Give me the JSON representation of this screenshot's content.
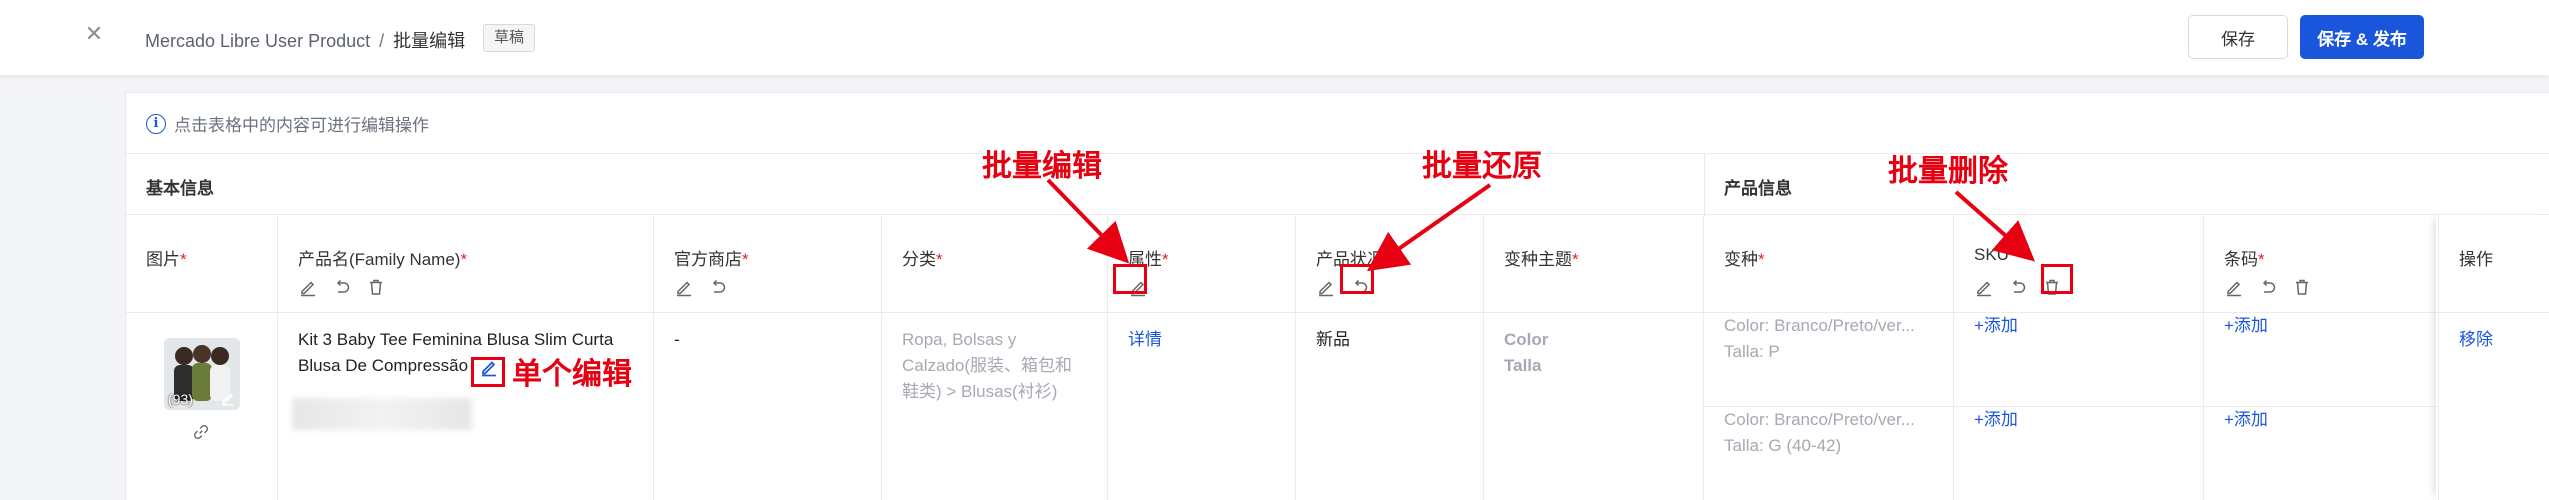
{
  "header": {
    "breadcrumb_root": "Mercado Libre User Product",
    "breadcrumb_sep": "/",
    "breadcrumb_current": "批量编辑",
    "status_tag": "草稿",
    "save_label": "保存",
    "publish_label": "保存 & 发布"
  },
  "info": {
    "hint": "点击表格中的内容可进行编辑操作",
    "icon": "info-icon"
  },
  "groups": {
    "basic": "基本信息",
    "product": "产品信息"
  },
  "columns": {
    "image": "图片",
    "name": "产品名(Family Name)",
    "store": "官方商店",
    "category": "分类",
    "attributes": "属性",
    "condition": "产品状况",
    "variant_theme": "变种主题",
    "variant": "变种",
    "sku": "SKU",
    "barcode": "条码",
    "action": "操作"
  },
  "row": {
    "image_count": "(93)",
    "name_line1": "Kit 3 Baby Tee Feminina Blusa Slim Curta",
    "name_line2": "Blusa De Compressão",
    "store": "-",
    "category_line1": "Ropa, Bolsas y",
    "category_line2": "Calzado(服装、箱包和",
    "category_line3": "鞋类) > Blusas(衬衫)",
    "attributes_link": "详情",
    "condition": "新品",
    "theme_1": "Color",
    "theme_2": "Talla",
    "variants": [
      {
        "color": "Color: Branco/Preto/ver...",
        "size": "Talla: P",
        "sku_add": "+添加",
        "barcode_add": "+添加"
      },
      {
        "color": "Color: Branco/Preto/ver...",
        "size": "Talla: G (40-42)",
        "sku_add": "+添加",
        "barcode_add": "+添加"
      }
    ],
    "remove": "移除"
  },
  "annotations": {
    "batch_edit": "批量编辑",
    "batch_restore": "批量还原",
    "batch_delete": "批量删除",
    "single_edit": "单个编辑"
  },
  "colors": {
    "primary": "#1a56db",
    "required": "#e02424",
    "annotation": "#e60012"
  }
}
